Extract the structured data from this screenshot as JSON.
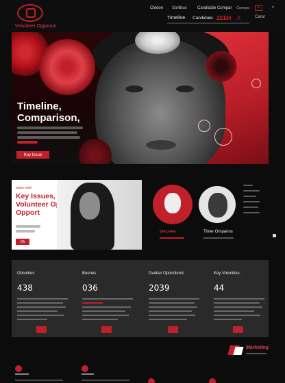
{
  "header": {
    "brand": "Volunteer Opporiun.",
    "nav": [
      "Cledon",
      "Sonlbus",
      "Candidate Compar",
      "Compar"
    ],
    "badge": "E",
    "close": "×",
    "sub": [
      "Timeline.",
      "Candidate",
      "ZEEH",
      "X",
      "Carar"
    ]
  },
  "hero": {
    "title": "Timeline, Comparison,",
    "button": "Koy Issue"
  },
  "card": {
    "kicker": "Issso noel.",
    "title": "Key Issues, Volunteer Opp Opport",
    "button": "Ofr"
  },
  "circles": {
    "label1": "WACHEE",
    "label2": "Timer Omparios"
  },
  "stats": [
    {
      "heading": "Oolunties",
      "value": "438"
    },
    {
      "heading": "Boones",
      "value": "036"
    },
    {
      "heading": "Dvebar Oporctients",
      "value": "2039"
    },
    {
      "heading": "Key Volunities.",
      "value": "44"
    }
  ],
  "footer": {
    "brand": "Marketing"
  },
  "colors": {
    "accent": "#c0202a",
    "background": "#0c0c0c",
    "panel": "#2a2a2a"
  },
  "icons": {
    "logo": "shield-logo-icon",
    "close": "close-icon",
    "marketing": "marketing-logo-icon",
    "footer": "red-dot-icon"
  }
}
